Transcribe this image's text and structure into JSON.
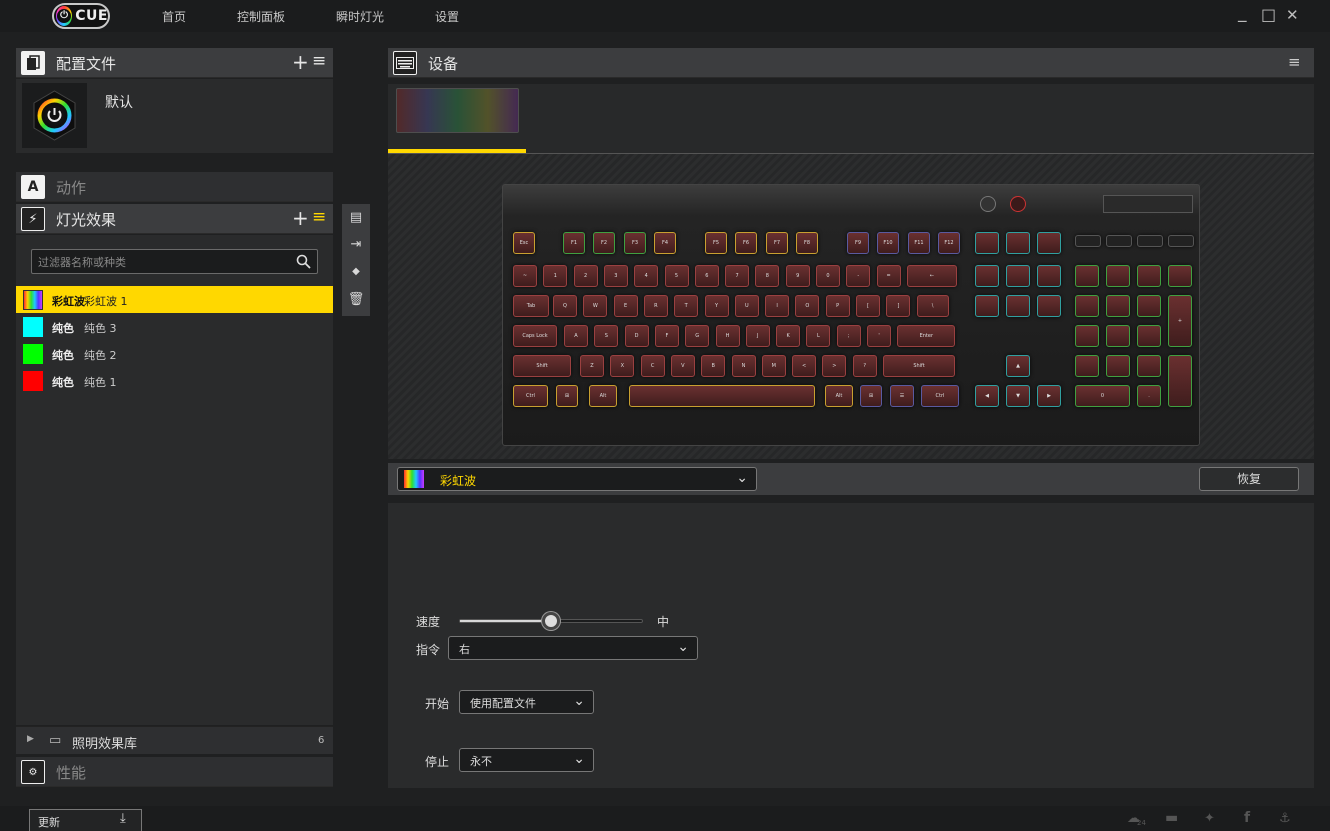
{
  "nav": {
    "items": [
      "首页",
      "控制面板",
      "瞬时灯光",
      "设置"
    ]
  },
  "window": {
    "minimize": "_",
    "maximize": "□",
    "close": "✕"
  },
  "profiles": {
    "title": "配置文件",
    "items": [
      {
        "name": "默认"
      }
    ]
  },
  "actions": {
    "title": "动作"
  },
  "lighting": {
    "title": "灯光效果",
    "search_placeholder": "过滤器名称或种类",
    "items": [
      {
        "name": "彩虹波",
        "sub": "彩虹波 1",
        "color": "#ffd800",
        "selected": true
      },
      {
        "name": "纯色",
        "sub": "纯色 3",
        "color": "#00ffff",
        "selected": false
      },
      {
        "name": "纯色",
        "sub": "纯色 2",
        "color": "#00ff00",
        "selected": false
      },
      {
        "name": "纯色",
        "sub": "纯色 1",
        "color": "#ff0000",
        "selected": false
      }
    ],
    "library": {
      "label": "照明效果库",
      "count": "6"
    }
  },
  "performance": {
    "title": "性能"
  },
  "devices": {
    "title": "设备"
  },
  "effect": {
    "selected": "彩虹波",
    "reset": "恢复"
  },
  "settings": {
    "speed_label": "速度",
    "speed_value": "中",
    "speed_fraction": 0.5,
    "direction_label": "指令",
    "direction_value": "右",
    "start_label": "开始",
    "start_value": "使用配置文件",
    "stop_label": "停止",
    "stop_value": "永不"
  },
  "footer": {
    "update_label": "更新",
    "social_count": "24"
  },
  "keyboard": {
    "rows": [
      [
        "Esc",
        "F1",
        "F2",
        "F3",
        "F4",
        "F5",
        "F6",
        "F7",
        "F8",
        "F9",
        "F10",
        "F11",
        "F12"
      ],
      [
        "~",
        "1",
        "2",
        "3",
        "4",
        "5",
        "6",
        "7",
        "8",
        "9",
        "0",
        "-",
        "=",
        "←"
      ],
      [
        "Tab",
        "Q",
        "W",
        "E",
        "R",
        "T",
        "Y",
        "U",
        "I",
        "O",
        "P",
        "[",
        "]",
        "\\"
      ],
      [
        "Caps Lock",
        "A",
        "S",
        "D",
        "F",
        "G",
        "H",
        "J",
        "K",
        "L",
        ";",
        "'",
        "Enter"
      ],
      [
        "Shift",
        "Z",
        "X",
        "C",
        "V",
        "B",
        "N",
        "M",
        "<",
        ">",
        "?",
        "Shift"
      ],
      [
        "Ctrl",
        "⊞",
        "Alt",
        "",
        "Alt",
        "⊞",
        "☰",
        "Ctrl"
      ]
    ]
  },
  "colors": {
    "accent": "#ffd800",
    "bg": "#1f2021",
    "panel": "#2a2b2c",
    "header": "#3c3d3f"
  }
}
